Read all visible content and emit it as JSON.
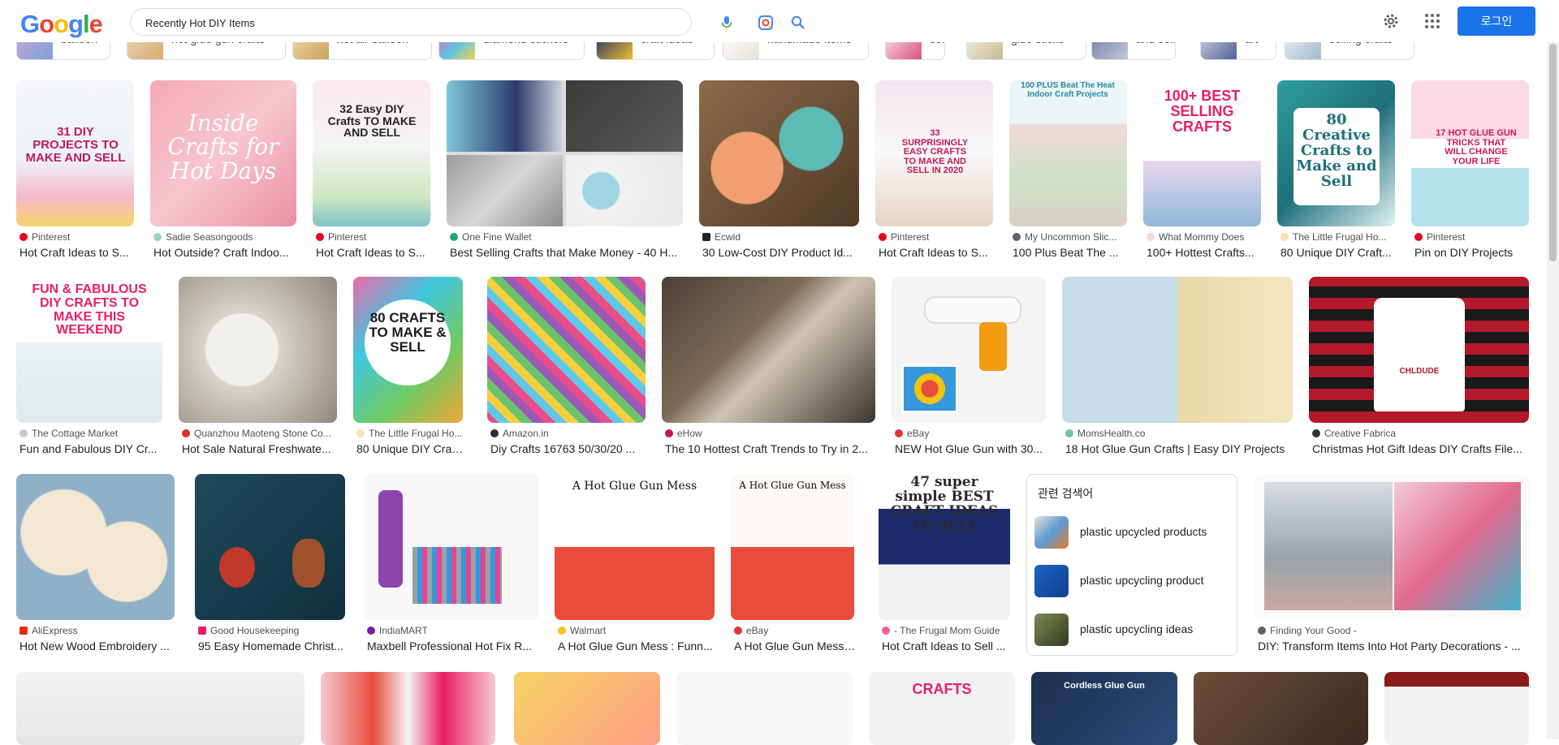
{
  "brand": {
    "logo_letters": [
      "G",
      "o",
      "o",
      "g",
      "l",
      "e"
    ],
    "logo_colors": [
      "#4285f4",
      "#ea4335",
      "#fbbc05",
      "#4285f4",
      "#34a853",
      "#ea4335"
    ]
  },
  "search": {
    "query": "Recently Hot DIY Items"
  },
  "header": {
    "login_label": "로그인"
  },
  "icons": {
    "mic": "microphone-icon",
    "lens": "lens-icon",
    "search": "search-icon",
    "settings": "gear-icon",
    "apps": "apps-grid-icon"
  },
  "chips": [
    {
      "label": "balloon"
    },
    {
      "label": "hot glue gun crafts"
    },
    {
      "label": "hot air balloon"
    },
    {
      "label": "diamond stickers"
    },
    {
      "label": "craft ideas"
    },
    {
      "label": "handmade items"
    },
    {
      "label": "sell"
    },
    {
      "label": "glue sticks"
    },
    {
      "label": "and sell"
    },
    {
      "label": "art"
    },
    {
      "label": "selling crafts"
    }
  ],
  "results": {
    "row1": [
      {
        "source": "Pinterest",
        "title": "Hot Craft Ideas to S...",
        "img_text": "31 DIY PROJECTS TO MAKE AND SELL"
      },
      {
        "source": "Sadie Seasongoods",
        "title": "Hot Outside? Craft Indoo...",
        "img_text": "Inside Crafts for Hot Days"
      },
      {
        "source": "Pinterest",
        "title": "Hot Craft Ideas to S...",
        "img_text": "32 Easy DIY Crafts TO MAKE AND SELL"
      },
      {
        "source": "One Fine Wallet",
        "title": "Best Selling Crafts that Make Money - 40 H...",
        "img_text": ""
      },
      {
        "source": "Ecwid",
        "title": "30 Low-Cost DIY Product Id...",
        "img_text": ""
      },
      {
        "source": "Pinterest",
        "title": "Hot Craft Ideas to S...",
        "img_text": "33 SURPRISINGLY EASY CRAFTS TO MAKE AND SELL IN 2020"
      },
      {
        "source": "My Uncommon Slic...",
        "title": "100 Plus Beat The ...",
        "img_text": "100 PLUS Beat The Heat Indoor Craft Projects"
      },
      {
        "source": "What Mommy Does",
        "title": "100+ Hottest Crafts...",
        "img_text": "100+ BEST SELLING CRAFTS"
      },
      {
        "source": "The Little Frugal Ho...",
        "title": "80 Unique DIY Craft...",
        "img_text": "80 Creative Crafts to Make and Sell"
      },
      {
        "source": "Pinterest",
        "title": "Pin on DIY Projects",
        "img_text": "17 HOT GLUE GUN TRICKS THAT WILL CHANGE YOUR LIFE"
      }
    ],
    "row2": [
      {
        "source": "The Cottage Market",
        "title": "Fun and Fabulous DIY Cr...",
        "img_text": "FUN & FABULOUS DIY CRAFTS TO MAKE THIS WEEKEND"
      },
      {
        "source": "Quanzhou Maoteng Stone Co...",
        "title": "Hot Sale Natural Freshwate...",
        "img_text": ""
      },
      {
        "source": "The Little Frugal Ho...",
        "title": "80 Unique DIY Craft...",
        "img_text": "80 CRAFTS TO MAKE & SELL"
      },
      {
        "source": "Amazon.in",
        "title": "Diy Crafts 16763 50/30/20 ...",
        "img_text": ""
      },
      {
        "source": "eHow",
        "title": "The 10 Hottest Craft Trends to Try in 2...",
        "img_text": ""
      },
      {
        "source": "eBay",
        "title": "NEW Hot Glue Gun with 30...",
        "img_text": ""
      },
      {
        "source": "MomsHealth.co",
        "title": "18 Hot Glue Gun Crafts | Easy DIY Projects",
        "img_text": ""
      },
      {
        "source": "Creative Fabrica",
        "title": "Christmas Hot Gift Ideas DIY Crafts File...",
        "img_text": "CHLDUDE"
      }
    ],
    "row3": [
      {
        "source": "AliExpress",
        "title": "Hot New Wood Embroidery ...",
        "img_text": ""
      },
      {
        "source": "Good Housekeeping",
        "title": "95 Easy Homemade Christ...",
        "img_text": ""
      },
      {
        "source": "IndiaMART",
        "title": "Maxbell Professional Hot Fix R...",
        "img_text": ""
      },
      {
        "source": "Walmart",
        "title": "A Hot Glue Gun Mess : Funn...",
        "img_text": "A Hot Glue Gun Mess"
      },
      {
        "source": "eBay",
        "title": "A Hot Glue Gun Mess: ...",
        "img_text": "A Hot Glue Gun Mess"
      },
      {
        "source": "- The Frugal Mom Guide",
        "title": "Hot Craft Ideas to Sell ...",
        "img_text": "47 super simple BEST CRAFT IDEAS TO SELL"
      },
      {
        "source": "Finding Your Good -",
        "title": "DIY: Transform Items Into Hot Party Decorations - ...",
        "img_text": ""
      }
    ],
    "row4_img_text": [
      "CRAFTS",
      "Cordless Glue Gun"
    ]
  },
  "related": {
    "heading": "관련 검색어",
    "items": [
      {
        "label": "plastic upcycled products"
      },
      {
        "label": "plastic upcycling product"
      },
      {
        "label": "plastic upcycling ideas"
      }
    ]
  }
}
